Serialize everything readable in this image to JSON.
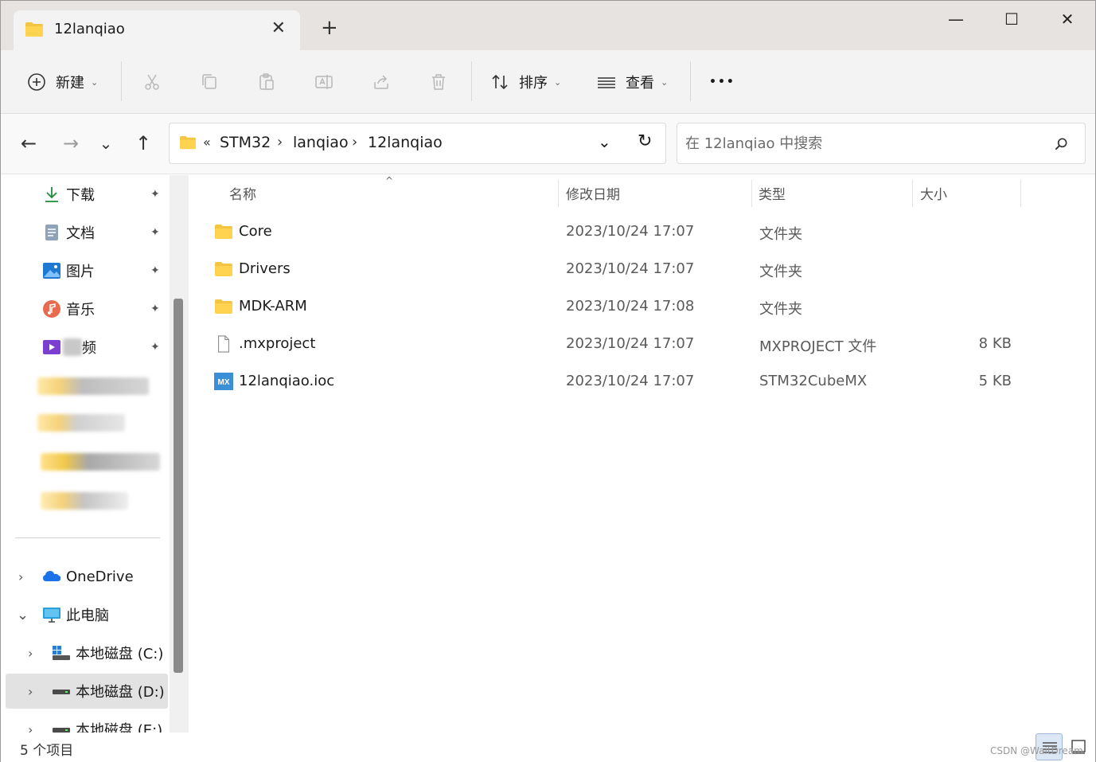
{
  "window": {
    "tab_title": "12lanqiao",
    "tab_close_glyph": "✕",
    "new_tab_glyph": "+",
    "minimize_glyph": "—",
    "maximize_glyph": "☐",
    "close_glyph": "✕"
  },
  "toolbar": {
    "new_label": "新建",
    "sort_label": "排序",
    "view_label": "查看",
    "more_glyph": "•••",
    "caret_glyph": "⌄",
    "icons": [
      "cut-icon",
      "copy-icon",
      "paste-icon",
      "rename-icon",
      "share-icon",
      "delete-icon"
    ]
  },
  "address_bar": {
    "overflow": "«",
    "crumbs": [
      "STM32",
      "lanqiao",
      "12lanqiao"
    ],
    "separator": "›",
    "dropdown_glyph": "⌄",
    "refresh_glyph": "↻"
  },
  "nav": {
    "back_glyph": "←",
    "forward_glyph": "→",
    "recent_glyph": "⌄",
    "up_glyph": "↑"
  },
  "search": {
    "placeholder": "在 12lanqiao 中搜索"
  },
  "sidebar": {
    "quick_access": [
      {
        "label": "下载",
        "icon": "download-icon"
      },
      {
        "label": "文档",
        "icon": "documents-icon"
      },
      {
        "label": "图片",
        "icon": "pictures-icon"
      },
      {
        "label": "音乐",
        "icon": "music-icon"
      },
      {
        "label": "频",
        "icon": "videos-icon"
      }
    ],
    "pin_glyph": "📌",
    "onedrive_label": "OneDrive",
    "this_pc_label": "此电脑",
    "drives": [
      {
        "label": "本地磁盘 (C:)"
      },
      {
        "label": "本地磁盘 (D:)"
      },
      {
        "label": "本地磁盘 (E:)"
      }
    ],
    "expand_glyph": "›",
    "collapse_glyph": "⌄"
  },
  "columns": {
    "name": "名称",
    "date": "修改日期",
    "type": "类型",
    "size": "大小",
    "sort_glyph": "^"
  },
  "files": [
    {
      "name": "Core",
      "date": "2023/10/24 17:07",
      "type": "文件夹",
      "size": "",
      "icon": "folder-icon"
    },
    {
      "name": "Drivers",
      "date": "2023/10/24 17:07",
      "type": "文件夹",
      "size": "",
      "icon": "folder-icon"
    },
    {
      "name": "MDK-ARM",
      "date": "2023/10/24 17:08",
      "type": "文件夹",
      "size": "",
      "icon": "folder-icon"
    },
    {
      "name": ".mxproject",
      "date": "2023/10/24 17:07",
      "type": "MXPROJECT 文件",
      "size": "8 KB",
      "icon": "file-icon"
    },
    {
      "name": "12lanqiao.ioc",
      "date": "2023/10/24 17:07",
      "type": "STM32CubeMX",
      "size": "5 KB",
      "icon": "cubemx-icon"
    }
  ],
  "status": {
    "item_count": "5 个项目",
    "watermark": "CSDN @WaitDream"
  },
  "colors": {
    "folder": "#f4c542",
    "accent": "#0067c0",
    "cubemx": "#3b8fd6"
  }
}
